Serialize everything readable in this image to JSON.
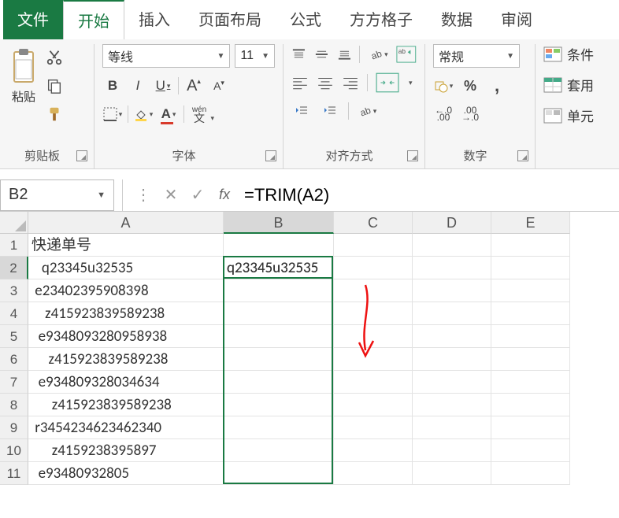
{
  "tabs": {
    "file": "文件",
    "home": "开始",
    "insert": "插入",
    "layout": "页面布局",
    "formulas": "公式",
    "ffgz": "方方格子",
    "data": "数据",
    "review": "审阅"
  },
  "ribbon": {
    "clipboard": {
      "label": "剪贴板",
      "paste": "粘贴"
    },
    "font": {
      "label": "字体",
      "name": "等线",
      "size": "11",
      "bold": "B",
      "italic": "I",
      "underline": "U",
      "grow": "A",
      "shrink": "A",
      "wen": "wén",
      "wen2": "文"
    },
    "align": {
      "label": "对齐方式"
    },
    "number": {
      "label": "数字",
      "format": "常规",
      "pct": "%",
      "comma": ",",
      "inc": ".00",
      "dec": ".0"
    },
    "styles": {
      "cond": "条件",
      "table": "套用",
      "cell": "单元"
    }
  },
  "namebox": "B2",
  "formula": "=TRIM(A2)",
  "cols": [
    "A",
    "B",
    "C",
    "D",
    "E"
  ],
  "rows": [
    {
      "n": "1",
      "A": "快递单号",
      "B": ""
    },
    {
      "n": "2",
      "A": "   q23345u32535",
      "B": "q23345u32535"
    },
    {
      "n": "3",
      "A": " e23402395908398",
      "B": ""
    },
    {
      "n": "4",
      "A": "    z415923839589238",
      "B": ""
    },
    {
      "n": "5",
      "A": "  e9348093280958938",
      "B": ""
    },
    {
      "n": "6",
      "A": "     z415923839589238",
      "B": ""
    },
    {
      "n": "7",
      "A": "  e934809328034634",
      "B": ""
    },
    {
      "n": "8",
      "A": "      z415923839589238",
      "B": ""
    },
    {
      "n": "9",
      "A": " r3454234623462340",
      "B": ""
    },
    {
      "n": "10",
      "A": "      z4159238395897",
      "B": ""
    },
    {
      "n": "11",
      "A": "  e93480932805",
      "B": ""
    }
  ],
  "activeCell": {
    "row": 2,
    "col": "B"
  },
  "fillRange": {
    "col": "B",
    "fromRow": 2,
    "toRow": 11
  }
}
